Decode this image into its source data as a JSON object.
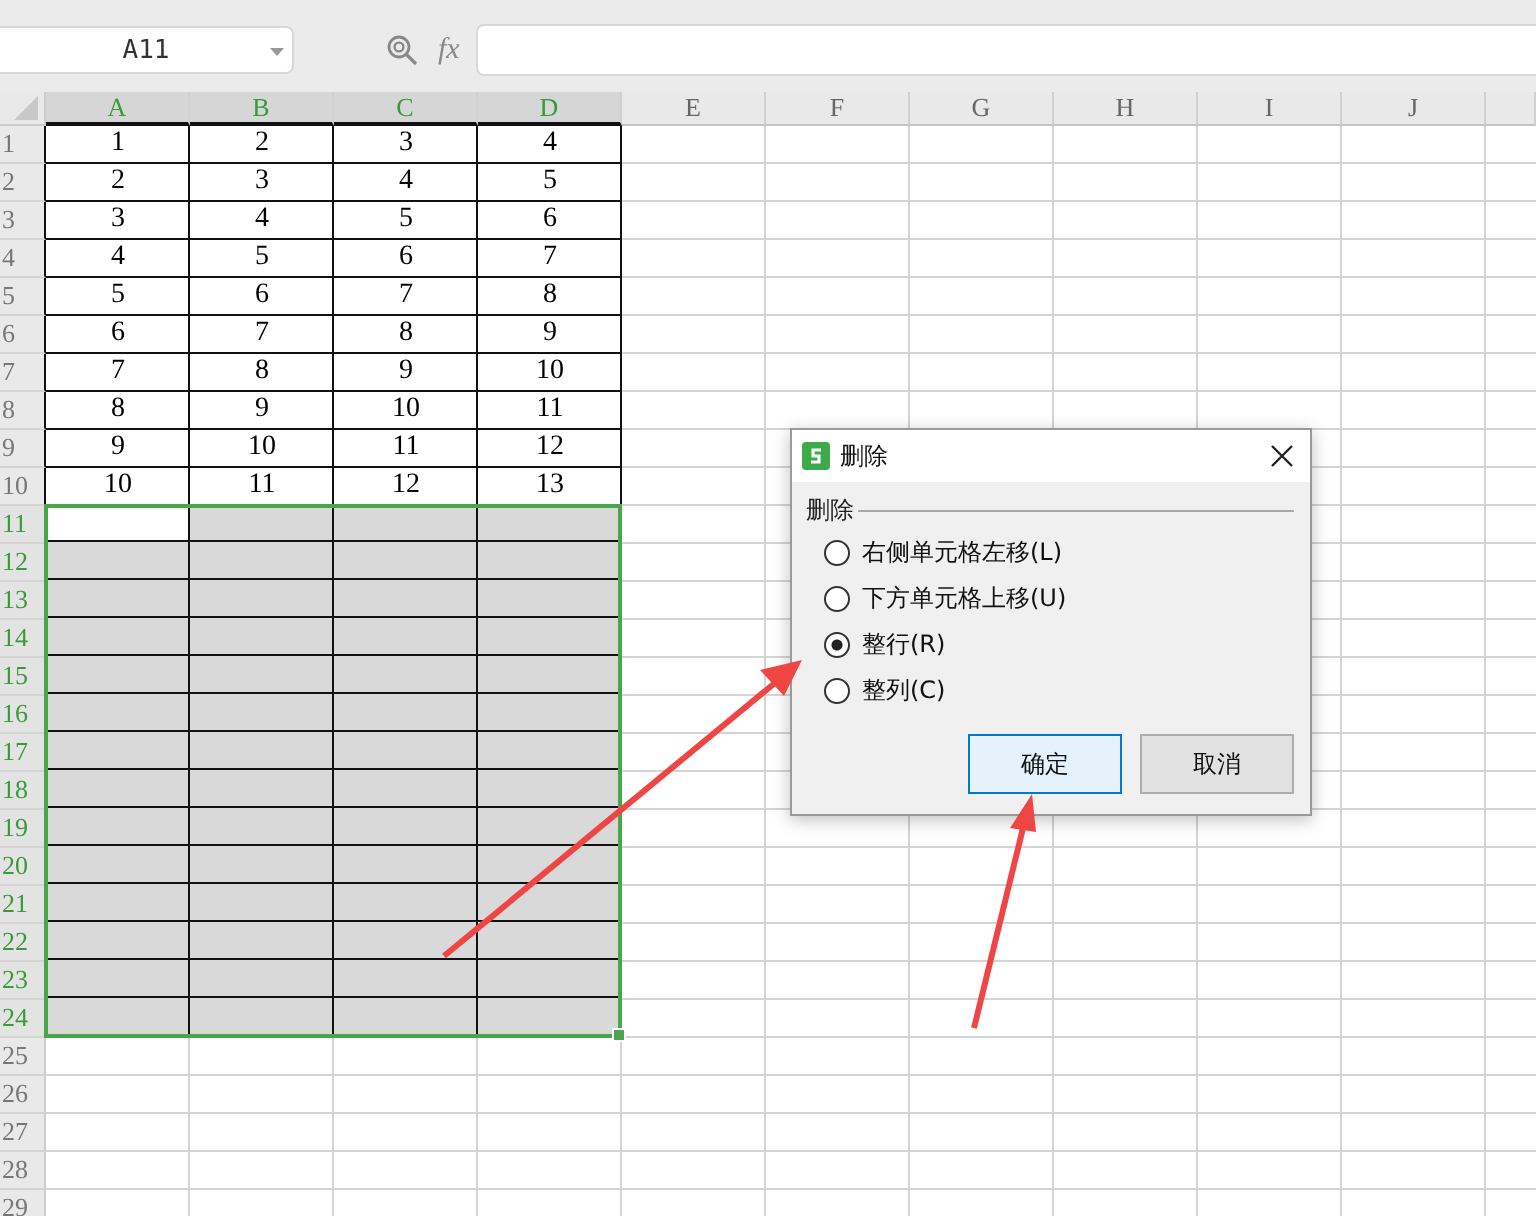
{
  "name_box": {
    "value": "A11"
  },
  "formula_bar": {
    "fx_label": "fx"
  },
  "columns": [
    {
      "label": "A",
      "selected": true,
      "in_table": true,
      "active": true
    },
    {
      "label": "B",
      "selected": true,
      "in_table": true,
      "active": false
    },
    {
      "label": "C",
      "selected": true,
      "in_table": true,
      "active": false
    },
    {
      "label": "D",
      "selected": true,
      "in_table": true,
      "active": false
    },
    {
      "label": "E",
      "selected": false,
      "in_table": false,
      "active": false
    },
    {
      "label": "F",
      "selected": false,
      "in_table": false,
      "active": false
    },
    {
      "label": "G",
      "selected": false,
      "in_table": false,
      "active": false
    },
    {
      "label": "H",
      "selected": false,
      "in_table": false,
      "active": false
    },
    {
      "label": "I",
      "selected": false,
      "in_table": false,
      "active": false
    },
    {
      "label": "J",
      "selected": false,
      "in_table": false,
      "active": false
    }
  ],
  "rows": [
    {
      "number": "1",
      "selected": false,
      "in_table": true,
      "active": false,
      "cells": [
        "1",
        "2",
        "3",
        "4"
      ]
    },
    {
      "number": "2",
      "selected": false,
      "in_table": true,
      "active": false,
      "cells": [
        "2",
        "3",
        "4",
        "5"
      ]
    },
    {
      "number": "3",
      "selected": false,
      "in_table": true,
      "active": false,
      "cells": [
        "3",
        "4",
        "5",
        "6"
      ]
    },
    {
      "number": "4",
      "selected": false,
      "in_table": true,
      "active": false,
      "cells": [
        "4",
        "5",
        "6",
        "7"
      ]
    },
    {
      "number": "5",
      "selected": false,
      "in_table": true,
      "active": false,
      "cells": [
        "5",
        "6",
        "7",
        "8"
      ]
    },
    {
      "number": "6",
      "selected": false,
      "in_table": true,
      "active": false,
      "cells": [
        "6",
        "7",
        "8",
        "9"
      ]
    },
    {
      "number": "7",
      "selected": false,
      "in_table": true,
      "active": false,
      "cells": [
        "7",
        "8",
        "9",
        "10"
      ]
    },
    {
      "number": "8",
      "selected": false,
      "in_table": true,
      "active": false,
      "cells": [
        "8",
        "9",
        "10",
        "11"
      ]
    },
    {
      "number": "9",
      "selected": false,
      "in_table": true,
      "active": false,
      "cells": [
        "9",
        "10",
        "11",
        "12"
      ]
    },
    {
      "number": "10",
      "selected": false,
      "in_table": true,
      "active": false,
      "cells": [
        "10",
        "11",
        "12",
        "13"
      ]
    },
    {
      "number": "11",
      "selected": true,
      "in_table": true,
      "active": true
    },
    {
      "number": "12",
      "selected": true,
      "in_table": true,
      "active": false
    },
    {
      "number": "13",
      "selected": true,
      "in_table": true,
      "active": false
    },
    {
      "number": "14",
      "selected": true,
      "in_table": true,
      "active": false
    },
    {
      "number": "15",
      "selected": true,
      "in_table": true,
      "active": false
    },
    {
      "number": "16",
      "selected": true,
      "in_table": true,
      "active": false
    },
    {
      "number": "17",
      "selected": true,
      "in_table": true,
      "active": false
    },
    {
      "number": "18",
      "selected": true,
      "in_table": true,
      "active": false
    },
    {
      "number": "19",
      "selected": true,
      "in_table": true,
      "active": false
    },
    {
      "number": "20",
      "selected": true,
      "in_table": true,
      "active": false
    },
    {
      "number": "21",
      "selected": true,
      "in_table": true,
      "active": false
    },
    {
      "number": "22",
      "selected": true,
      "in_table": true,
      "active": false
    },
    {
      "number": "23",
      "selected": true,
      "in_table": true,
      "active": false
    },
    {
      "number": "24",
      "selected": true,
      "in_table": true,
      "active": false
    },
    {
      "number": "25",
      "selected": false,
      "in_table": false,
      "active": false
    },
    {
      "number": "26",
      "selected": false,
      "in_table": false,
      "active": false
    },
    {
      "number": "27",
      "selected": false,
      "in_table": false,
      "active": false
    },
    {
      "number": "28",
      "selected": false,
      "in_table": false,
      "active": false
    },
    {
      "number": "29",
      "selected": false,
      "in_table": false,
      "active": false
    }
  ],
  "dialog": {
    "title": "删除",
    "group_label": "删除",
    "options": [
      {
        "label": "右侧单元格左移(L)",
        "selected": false
      },
      {
        "label": "下方单元格上移(U)",
        "selected": false
      },
      {
        "label": "整行(R)",
        "selected": true
      },
      {
        "label": "整列(C)",
        "selected": false
      }
    ],
    "buttons": [
      {
        "label": "确定",
        "kind": "primary"
      },
      {
        "label": "取消",
        "kind": "secondary"
      }
    ]
  }
}
